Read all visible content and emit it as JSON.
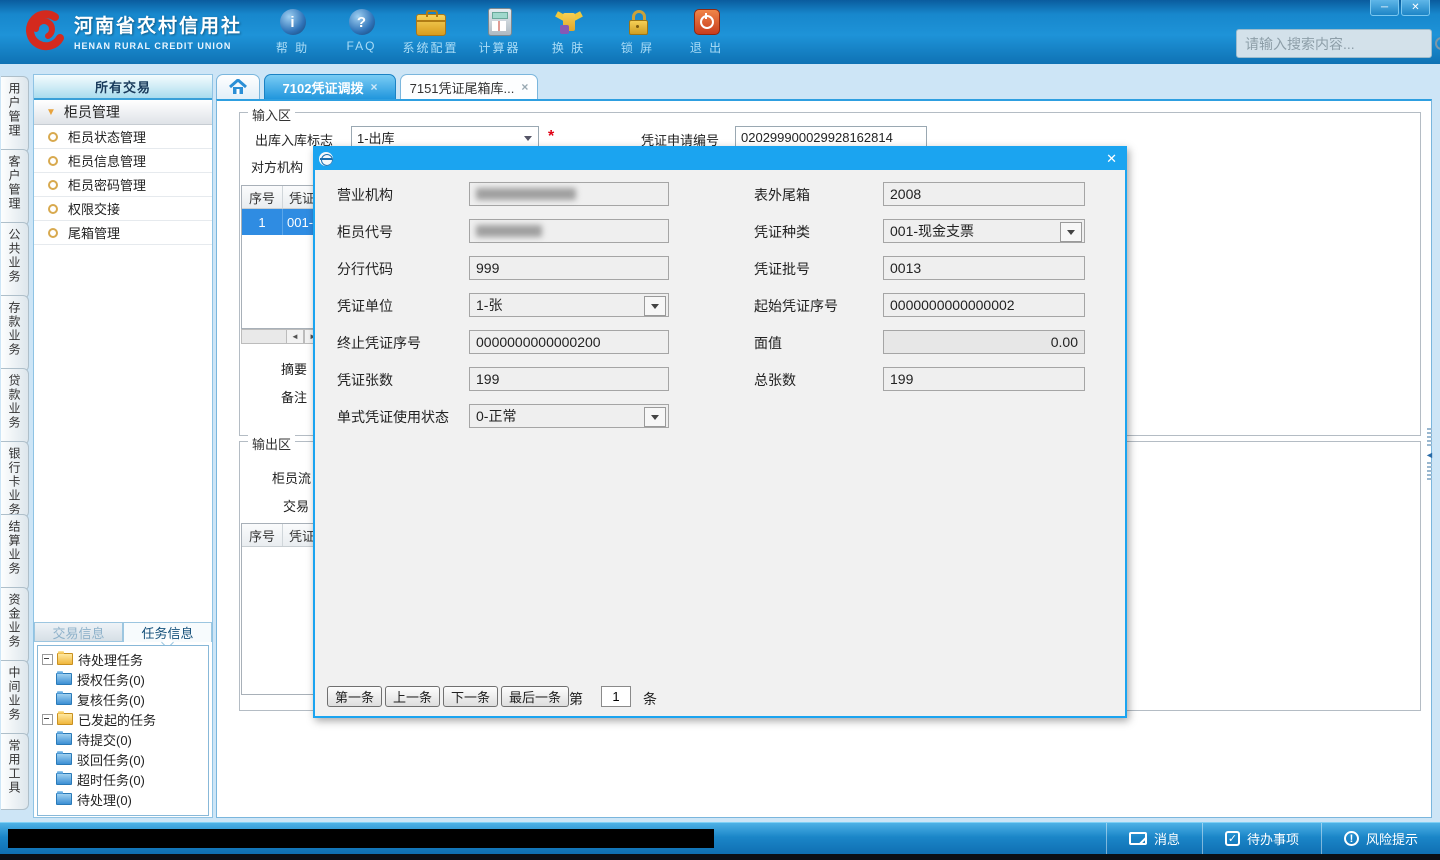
{
  "header": {
    "logo_title": "河南省农村信用社",
    "logo_subtitle": "HENAN RURAL CREDIT UNION",
    "toolbar": [
      "帮 助",
      "FAQ",
      "系统配置",
      "计算器",
      "换 肤",
      "锁 屏",
      "退 出"
    ],
    "search_placeholder": "请输入搜索内容..."
  },
  "icons": {
    "minimize": "─",
    "close": "✕",
    "tab_close": "×",
    "modal_close": "✕",
    "info": "i",
    "question": "?",
    "group_arrow": "▼",
    "scroll_left": "◄",
    "scroll_right": "►",
    "collapse_left": "◄",
    "check": "✓",
    "exclaim": "!"
  },
  "left_tabs": [
    "用户管理",
    "客户管理",
    "公共业务",
    "存款业务",
    "贷款业务",
    "银行卡业务",
    "结算业务",
    "资金业务",
    "中间业务",
    "常用工具"
  ],
  "sidebar": {
    "header": "所有交易",
    "group": "柜员管理",
    "items": [
      "柜员状态管理",
      "柜员信息管理",
      "柜员密码管理",
      "权限交接",
      "尾箱管理"
    ],
    "bottom_tabs": [
      "交易信息",
      "任务信息"
    ],
    "task_tree": {
      "groups": [
        {
          "label": "待处理任务",
          "children": [
            "授权任务(0)",
            "复核任务(0)"
          ]
        },
        {
          "label": "已发起的任务",
          "children": [
            "待提交(0)",
            "驳回任务(0)",
            "超时任务(0)",
            "待处理(0)"
          ]
        }
      ]
    }
  },
  "tabs": {
    "tab1": "7102凭证调拨",
    "tab2": "7151凭证尾箱库..."
  },
  "content": {
    "input_section": "输入区",
    "inout_label": "出库入库标志",
    "inout_value": "1-出库",
    "required_mark": "*",
    "apply_no_label": "凭证申请编号",
    "apply_no_value": "020299900029928162814",
    "partner_label": "对方机构",
    "input_table": {
      "headers": [
        "序号",
        "凭证"
      ],
      "row": {
        "seq": "1",
        "value": "001-"
      }
    },
    "summary_label": "摘要",
    "remark_label": "备注",
    "output_section": "输出区",
    "output_label1": "柜员流",
    "output_label2": "交易",
    "output_table": {
      "headers": [
        "序号",
        "凭证"
      ]
    }
  },
  "modal": {
    "fields_left": [
      {
        "label": "营业机构",
        "value": ""
      },
      {
        "label": "柜员代号",
        "value": ""
      },
      {
        "label": "分行代码",
        "value": "999"
      },
      {
        "label": "凭证单位",
        "value": "1-张"
      },
      {
        "label": "终止凭证序号",
        "value": "0000000000000200"
      },
      {
        "label": "凭证张数",
        "value": "199"
      },
      {
        "label": "单式凭证使用状态",
        "value": "0-正常"
      }
    ],
    "fields_right": [
      {
        "label": "表外尾箱",
        "value": "2008"
      },
      {
        "label": "凭证种类",
        "value": "001-现金支票"
      },
      {
        "label": "凭证批号",
        "value": "0013"
      },
      {
        "label": "起始凭证序号",
        "value": "0000000000000002"
      },
      {
        "label": "面值",
        "value": "0.00"
      },
      {
        "label": "总张数",
        "value": "199"
      }
    ],
    "nav_buttons": [
      "第一条",
      "上一条",
      "下一条",
      "最后一条"
    ],
    "nav_prefix": "第",
    "nav_value": "1",
    "nav_suffix": "条"
  },
  "statusbar": {
    "items": [
      "消息",
      "待办事项",
      "风险提示"
    ]
  },
  "colors": {
    "accent_blue": "#1ba4f0",
    "header_blue": "#1787cc",
    "selected_row": "#2f8ce2"
  }
}
